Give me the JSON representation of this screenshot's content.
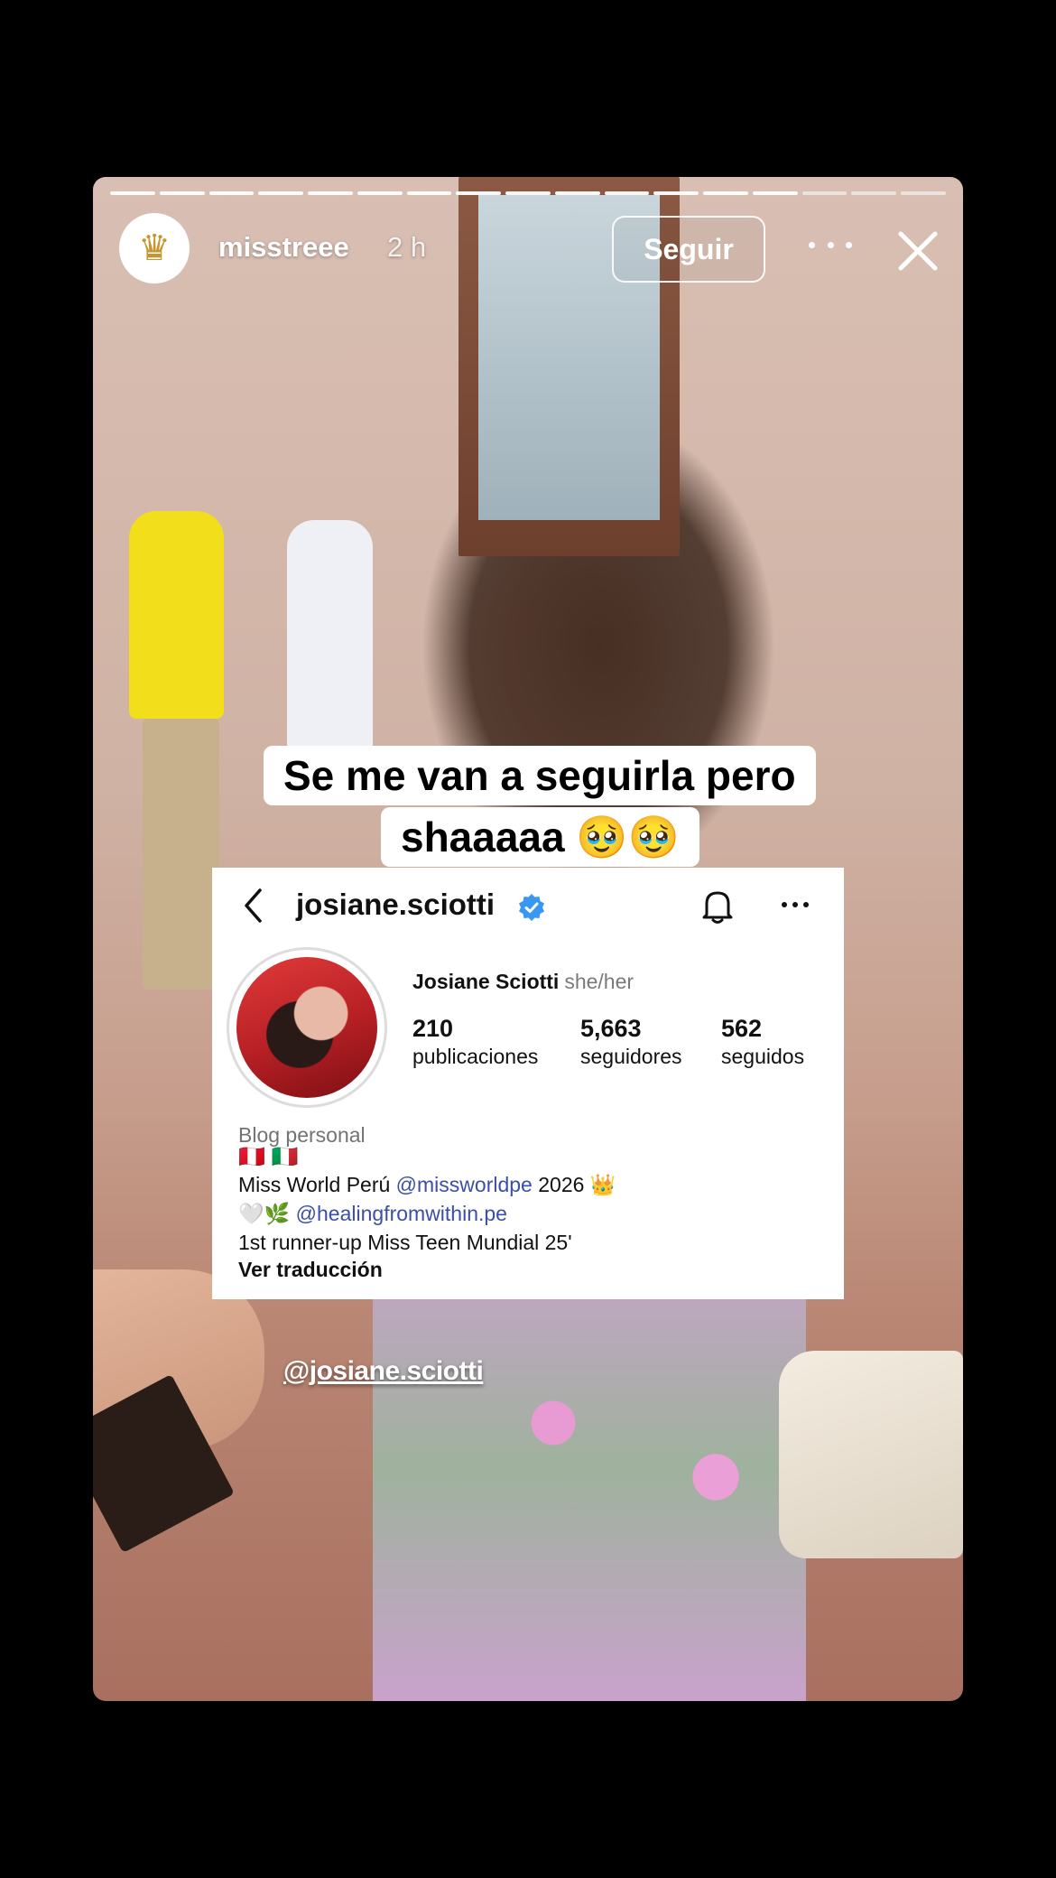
{
  "story": {
    "progress_segments_total": 17,
    "progress_segments_viewed": 14,
    "header": {
      "avatar_icon": "crown-icon",
      "username": "misstreee",
      "time": "2 h",
      "follow_label": "Seguir"
    },
    "caption": {
      "line1": "Se me van a seguirla pero",
      "line2": "shaaaaa 🥹🥹"
    },
    "watermark": "@josiane.sciotti"
  },
  "profile": {
    "username": "josiane.sciotti",
    "full_name": "Josiane Sciotti",
    "pronouns": "she/her",
    "stats": [
      {
        "value": "210",
        "label": "publicaciones"
      },
      {
        "value": "5,663",
        "label": "seguidores"
      },
      {
        "value": "562",
        "label": "seguidos"
      }
    ],
    "category": "Blog personal",
    "flags": "🇵🇪 🇮🇹",
    "bio": {
      "line1_pre": "Miss World Perú ",
      "line1_mention": "@missworldpe",
      "line1_post": " 2026 👑",
      "line2_emoji": "🤍🌿 ",
      "line2_mention": "@healingfromwithin.pe",
      "line3": "1st runner-up Miss Teen Mundial 25'"
    },
    "see_translation": "Ver traducción",
    "verified_color": "#3897f0"
  }
}
